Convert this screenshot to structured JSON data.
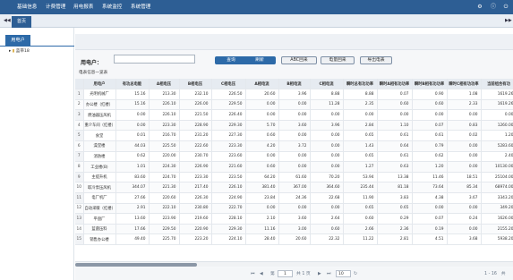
{
  "topbar": {
    "nav": [
      "基础信息",
      "计费管理",
      "用电报表",
      "系统监控",
      "系统管理"
    ],
    "icons": [
      "settings-icon",
      "info-icon",
      "power-icon"
    ]
  },
  "tabbar": {
    "home_tab": "首页"
  },
  "sidebar": {
    "tab": "用电户",
    "tree_root": "蓝带18"
  },
  "search": {
    "label": "用电户：",
    "value": "",
    "placeholder": ""
  },
  "buttons": {
    "query": "查询",
    "reset": "刷新",
    "abc": "ABC回来",
    "meter": "电量回来",
    "export": "导出电表"
  },
  "info": "电表信息一览表",
  "table": {
    "columns": [
      "用电户",
      "有功总电能",
      "A相电压",
      "B相电压",
      "C相电压",
      "A相电流",
      "B相电流",
      "C相电流",
      "瞬时总有功功率",
      "瞬时A相有功功率",
      "瞬时B相有功功率",
      "瞬时C相有功功率",
      "当前组合有功"
    ],
    "rows": [
      [
        "1",
        "光明机械厂",
        "15.16",
        "213.30",
        "232.10",
        "226.50",
        "20.60",
        "3.96",
        "8.88",
        "8.88",
        "0.07",
        "0.90",
        "1.08",
        "1619.26"
      ],
      [
        "2",
        "办公楼（红楼）",
        "15.16",
        "226.10",
        "226.00",
        "229.50",
        "0.00",
        "0.00",
        "11.28",
        "2.35",
        "0.60",
        "0.60",
        "2.33",
        "1619.26"
      ],
      [
        "3",
        "燃油器压风机",
        "0.00",
        "226.10",
        "221.50",
        "226.40",
        "0.00",
        "0.00",
        "0.00",
        "0.00",
        "0.00",
        "0.00",
        "0.00",
        "0.00"
      ],
      [
        "4",
        "重介车间（红楼）",
        "0.00",
        "223.30",
        "228.90",
        "229.30",
        "5.70",
        "3.60",
        "3.96",
        "2.84",
        "1.10",
        "0.07",
        "0.83",
        "1260.00"
      ],
      [
        "5",
        "食堂",
        "0.01",
        "216.70",
        "231.20",
        "227.30",
        "0.60",
        "0.00",
        "0.00",
        "0.65",
        "0.61",
        "0.61",
        "0.02",
        "1.20"
      ],
      [
        "6",
        "澡堂楼",
        "44.03",
        "225.50",
        "222.60",
        "223.30",
        "4.20",
        "3.72",
        "0.00",
        "1.43",
        "0.64",
        "0.79",
        "0.00",
        "5283.60"
      ],
      [
        "7",
        "消防楼",
        "0.62",
        "220.00",
        "230.70",
        "223.60",
        "0.00",
        "0.00",
        "0.00",
        "0.65",
        "0.61",
        "0.62",
        "0.00",
        "2.40"
      ],
      [
        "8",
        "工业楼(B)",
        "1.01",
        "224.30",
        "226.90",
        "221.60",
        "0.60",
        "0.00",
        "0.00",
        "1.27",
        "0.63",
        "1.20",
        "0.00",
        "10130.00"
      ],
      [
        "9",
        "主提升机",
        "83.60",
        "224.70",
        "223.30",
        "223.50",
        "64.20",
        "61.60",
        "70.20",
        "53.94",
        "13.38",
        "11.46",
        "18.51",
        "25104.00"
      ],
      [
        "10",
        "取冷泵压风机",
        "344.07",
        "221.30",
        "217.40",
        "226.10",
        "381.40",
        "367.00",
        "364.60",
        "235.44",
        "81.18",
        "73.64",
        "85.34",
        "68974.00"
      ],
      [
        "11",
        "电厂机厂",
        "27.66",
        "220.60",
        "226.30",
        "224.90",
        "23.84",
        "24.36",
        "22.68",
        "11.90",
        "3.83",
        "4.38",
        "3.67",
        "3343.20"
      ],
      [
        "12",
        "自动采暖（红楼）",
        "2.91",
        "222.10",
        "230.80",
        "222.70",
        "0.00",
        "0.00",
        "0.00",
        "0.65",
        "0.65",
        "0.00",
        "0.00",
        "349.20"
      ],
      [
        "13",
        "平盘厂",
        "13.60",
        "223.90",
        "219.60",
        "228.10",
        "2.10",
        "3.60",
        "2.64",
        "0.60",
        "0.29",
        "0.07",
        "0.24",
        "1626.00"
      ],
      [
        "14",
        "蓝菌压料",
        "17.66",
        "229.50",
        "220.90",
        "229.30",
        "11.16",
        "3.00",
        "0.60",
        "2.66",
        "2.36",
        "0.19",
        "0.00",
        "2155.20"
      ],
      [
        "15",
        "销售办公楼",
        "49.40",
        "225.70",
        "223.20",
        "224.10",
        "28.40",
        "20.60",
        "22.32",
        "11.22",
        "2.81",
        "4.51",
        "3.68",
        "5938.20"
      ]
    ]
  },
  "pager": {
    "first": "⏮",
    "prev": "◀",
    "page_label": "第",
    "page": "1",
    "of_pages": "共 1 页",
    "next": "▶",
    "last": "⏭",
    "refresh": "↻",
    "page_size": "10",
    "summary": "1 - 16　共"
  }
}
